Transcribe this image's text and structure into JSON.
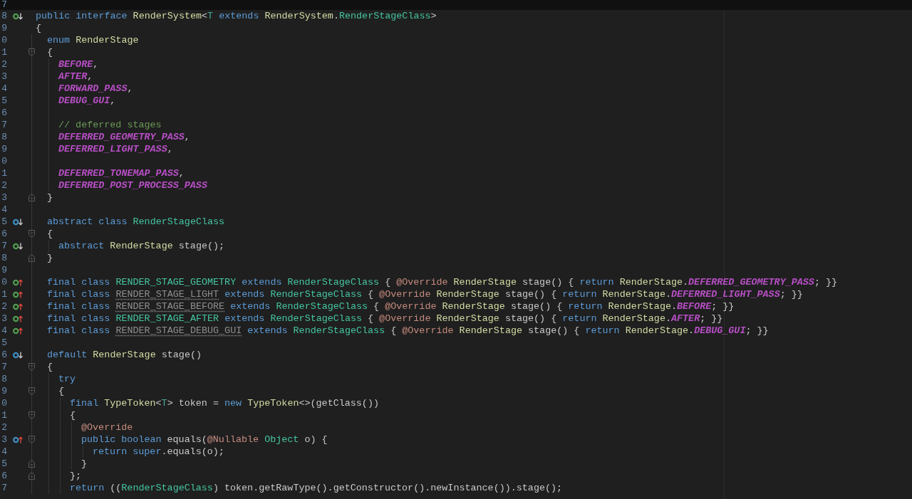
{
  "editor": {
    "lines": [
      {
        "number": "7"
      },
      {
        "number": "8",
        "marker": {
          "kind": "implemented",
          "color": "#4f9d4f"
        },
        "tokens": [
          {
            "text": "public interface ",
            "kind": "keyword"
          },
          {
            "text": "RenderSystem",
            "kind": "type"
          },
          {
            "text": "<",
            "kind": "plain"
          },
          {
            "text": "T",
            "kind": "type-param"
          },
          {
            "text": " extends ",
            "kind": "keyword"
          },
          {
            "text": "RenderSystem",
            "kind": "type"
          },
          {
            "text": ".",
            "kind": "plain"
          },
          {
            "text": "RenderStageClass",
            "kind": "type-ref"
          },
          {
            "text": ">",
            "kind": "plain"
          }
        ]
      },
      {
        "number": "9",
        "tokens": [
          {
            "text": "{",
            "kind": "plain"
          }
        ],
        "children": [
          {
            "number": "0",
            "tokens": [
              {
                "text": "enum ",
                "kind": "keyword"
              },
              {
                "text": "RenderStage",
                "kind": "type"
              }
            ]
          },
          {
            "number": "1",
            "fold": {
              "kind": "start"
            },
            "tokens": [
              {
                "text": "{",
                "kind": "plain"
              }
            ],
            "children": [
              {
                "number": "2",
                "tokens": [
                  {
                    "text": "BEFORE",
                    "kind": "enum-constant"
                  },
                  {
                    "text": ",",
                    "kind": "plain"
                  }
                ]
              },
              {
                "number": "3",
                "tokens": [
                  {
                    "text": "AFTER",
                    "kind": "enum-constant"
                  },
                  {
                    "text": ",",
                    "kind": "plain"
                  }
                ]
              },
              {
                "number": "4",
                "tokens": [
                  {
                    "text": "FORWARD_PASS",
                    "kind": "enum-constant"
                  },
                  {
                    "text": ",",
                    "kind": "plain"
                  }
                ]
              },
              {
                "number": "5",
                "tokens": [
                  {
                    "text": "DEBUG_GUI",
                    "kind": "enum-constant"
                  },
                  {
                    "text": ",",
                    "kind": "plain"
                  }
                ]
              },
              {
                "number": "6"
              },
              {
                "number": "7",
                "tokens": [
                  {
                    "text": "// deferred stages",
                    "kind": "comment"
                  }
                ]
              },
              {
                "number": "8",
                "tokens": [
                  {
                    "text": "DEFERRED_GEOMETRY_PASS",
                    "kind": "enum-constant"
                  },
                  {
                    "text": ",",
                    "kind": "plain"
                  }
                ]
              },
              {
                "number": "9",
                "tokens": [
                  {
                    "text": "DEFERRED_LIGHT_PASS",
                    "kind": "enum-constant"
                  },
                  {
                    "text": ",",
                    "kind": "plain"
                  }
                ]
              },
              {
                "number": "0"
              },
              {
                "number": "1",
                "tokens": [
                  {
                    "text": "DEFERRED_TONEMAP_PASS",
                    "kind": "enum-constant"
                  },
                  {
                    "text": ",",
                    "kind": "plain"
                  }
                ]
              },
              {
                "number": "2",
                "tokens": [
                  {
                    "text": "DEFERRED_POST_PROCESS_PASS",
                    "kind": "enum-constant"
                  }
                ]
              }
            ]
          },
          {
            "number": "3",
            "fold": {
              "kind": "end"
            },
            "tokens": [
              {
                "text": "}",
                "kind": "plain"
              }
            ]
          },
          {
            "number": "4"
          },
          {
            "number": "5",
            "marker": {
              "kind": "implemented",
              "color": "#3d8ec4"
            },
            "tokens": [
              {
                "text": "abstract class ",
                "kind": "keyword"
              },
              {
                "text": "RenderStageClass",
                "kind": "type-ref"
              }
            ]
          },
          {
            "number": "6",
            "fold": {
              "kind": "start"
            },
            "tokens": [
              {
                "text": "{",
                "kind": "plain"
              }
            ],
            "children": [
              {
                "number": "7",
                "marker": {
                  "kind": "implemented",
                  "color": "#4f9d4f"
                },
                "tokens": [
                  {
                    "text": "abstract ",
                    "kind": "keyword"
                  },
                  {
                    "text": "RenderStage",
                    "kind": "type"
                  },
                  {
                    "text": " stage();",
                    "kind": "plain"
                  }
                ]
              }
            ]
          },
          {
            "number": "8",
            "fold": {
              "kind": "end"
            },
            "tokens": [
              {
                "text": "}",
                "kind": "plain"
              }
            ]
          },
          {
            "number": "9"
          },
          {
            "number": "0",
            "marker": {
              "kind": "overriding",
              "color": "#4f9d4f"
            },
            "tokens": [
              {
                "text": "final class ",
                "kind": "keyword"
              },
              {
                "text": "RENDER_STAGE_GEOMETRY",
                "kind": "type-ref"
              },
              {
                "text": " extends ",
                "kind": "keyword"
              },
              {
                "text": "RenderStageClass",
                "kind": "type-ref"
              },
              {
                "text": " { ",
                "kind": "plain"
              },
              {
                "text": "@Override",
                "kind": "annotation"
              },
              {
                "text": " RenderStage",
                "kind": "type"
              },
              {
                "text": " stage() { ",
                "kind": "plain"
              },
              {
                "text": "return",
                "kind": "keyword"
              },
              {
                "text": " RenderStage",
                "kind": "type"
              },
              {
                "text": ".",
                "kind": "plain"
              },
              {
                "text": "DEFERRED_GEOMETRY_PASS",
                "kind": "enum-constant"
              },
              {
                "text": "; }}",
                "kind": "plain"
              }
            ]
          },
          {
            "number": "1",
            "marker": {
              "kind": "overriding",
              "color": "#4f9d4f"
            },
            "tokens": [
              {
                "text": "final class ",
                "kind": "keyword"
              },
              {
                "text": "RENDER_STAGE_LIGHT",
                "kind": "unused"
              },
              {
                "text": " extends ",
                "kind": "keyword"
              },
              {
                "text": "RenderStageClass",
                "kind": "type-ref"
              },
              {
                "text": " { ",
                "kind": "plain"
              },
              {
                "text": "@Override",
                "kind": "annotation"
              },
              {
                "text": " RenderStage",
                "kind": "type"
              },
              {
                "text": " stage() { ",
                "kind": "plain"
              },
              {
                "text": "return",
                "kind": "keyword"
              },
              {
                "text": " RenderStage",
                "kind": "type"
              },
              {
                "text": ".",
                "kind": "plain"
              },
              {
                "text": "DEFERRED_LIGHT_PASS",
                "kind": "enum-constant"
              },
              {
                "text": "; }}",
                "kind": "plain"
              }
            ]
          },
          {
            "number": "2",
            "marker": {
              "kind": "overriding",
              "color": "#4f9d4f"
            },
            "tokens": [
              {
                "text": "final class ",
                "kind": "keyword"
              },
              {
                "text": "RENDER_STAGE_BEFORE",
                "kind": "unused"
              },
              {
                "text": " extends ",
                "kind": "keyword"
              },
              {
                "text": "RenderStageClass",
                "kind": "type-ref"
              },
              {
                "text": " { ",
                "kind": "plain"
              },
              {
                "text": "@Override",
                "kind": "annotation"
              },
              {
                "text": " RenderStage",
                "kind": "type"
              },
              {
                "text": " stage() { ",
                "kind": "plain"
              },
              {
                "text": "return",
                "kind": "keyword"
              },
              {
                "text": " RenderStage",
                "kind": "type"
              },
              {
                "text": ".",
                "kind": "plain"
              },
              {
                "text": "BEFORE",
                "kind": "enum-constant"
              },
              {
                "text": "; }}",
                "kind": "plain"
              }
            ]
          },
          {
            "number": "3",
            "marker": {
              "kind": "overriding",
              "color": "#4f9d4f"
            },
            "tokens": [
              {
                "text": "final class ",
                "kind": "keyword"
              },
              {
                "text": "RENDER_STAGE_AFTER",
                "kind": "type-ref"
              },
              {
                "text": " extends ",
                "kind": "keyword"
              },
              {
                "text": "RenderStageClass",
                "kind": "type-ref"
              },
              {
                "text": " { ",
                "kind": "plain"
              },
              {
                "text": "@Override",
                "kind": "annotation"
              },
              {
                "text": " RenderStage",
                "kind": "type"
              },
              {
                "text": " stage() { ",
                "kind": "plain"
              },
              {
                "text": "return",
                "kind": "keyword"
              },
              {
                "text": " RenderStage",
                "kind": "type"
              },
              {
                "text": ".",
                "kind": "plain"
              },
              {
                "text": "AFTER",
                "kind": "enum-constant"
              },
              {
                "text": "; }}",
                "kind": "plain"
              }
            ]
          },
          {
            "number": "4",
            "marker": {
              "kind": "overriding",
              "color": "#4f9d4f"
            },
            "tokens": [
              {
                "text": "final class ",
                "kind": "keyword"
              },
              {
                "text": "RENDER_STAGE_DEBUG_GUI",
                "kind": "unused"
              },
              {
                "text": " extends ",
                "kind": "keyword"
              },
              {
                "text": "RenderStageClass",
                "kind": "type-ref"
              },
              {
                "text": " { ",
                "kind": "plain"
              },
              {
                "text": "@Override",
                "kind": "annotation"
              },
              {
                "text": " RenderStage",
                "kind": "type"
              },
              {
                "text": " stage() { ",
                "kind": "plain"
              },
              {
                "text": "return",
                "kind": "keyword"
              },
              {
                "text": " RenderStage",
                "kind": "type"
              },
              {
                "text": ".",
                "kind": "plain"
              },
              {
                "text": "DEBUG_GUI",
                "kind": "enum-constant"
              },
              {
                "text": "; }}",
                "kind": "plain"
              }
            ]
          },
          {
            "number": "5"
          },
          {
            "number": "6",
            "marker": {
              "kind": "implemented",
              "color": "#3d8ec4"
            },
            "tokens": [
              {
                "text": "default ",
                "kind": "keyword"
              },
              {
                "text": "RenderStage",
                "kind": "type"
              },
              {
                "text": " stage()",
                "kind": "plain"
              }
            ]
          },
          {
            "number": "7",
            "fold": {
              "kind": "start"
            },
            "tokens": [
              {
                "text": "{",
                "kind": "plain"
              }
            ],
            "children": [
              {
                "number": "8",
                "tokens": [
                  {
                    "text": "try",
                    "kind": "keyword"
                  }
                ]
              },
              {
                "number": "9",
                "fold": {
                  "kind": "start"
                },
                "tokens": [
                  {
                    "text": "{",
                    "kind": "plain"
                  }
                ],
                "children": [
                  {
                    "number": "0",
                    "tokens": [
                      {
                        "text": "final ",
                        "kind": "keyword"
                      },
                      {
                        "text": "TypeToken",
                        "kind": "type"
                      },
                      {
                        "text": "<",
                        "kind": "plain"
                      },
                      {
                        "text": "T",
                        "kind": "type-param"
                      },
                      {
                        "text": "> token = ",
                        "kind": "plain"
                      },
                      {
                        "text": "new",
                        "kind": "keyword"
                      },
                      {
                        "text": " TypeToken",
                        "kind": "type"
                      },
                      {
                        "text": "<>(getClass())",
                        "kind": "plain"
                      }
                    ]
                  },
                  {
                    "number": "1",
                    "fold": {
                      "kind": "start"
                    },
                    "tokens": [
                      {
                        "text": "{",
                        "kind": "plain"
                      }
                    ],
                    "children": [
                      {
                        "number": "2",
                        "tokens": [
                          {
                            "text": "@Override",
                            "kind": "annotation"
                          }
                        ]
                      },
                      {
                        "number": "3",
                        "marker": {
                          "kind": "overriding",
                          "color": "#3d8ec4"
                        },
                        "fold": {
                          "kind": "start"
                        },
                        "tokens": [
                          {
                            "text": "public boolean",
                            "kind": "keyword"
                          },
                          {
                            "text": " equals(",
                            "kind": "plain"
                          },
                          {
                            "text": "@Nullable",
                            "kind": "annotation"
                          },
                          {
                            "text": " Object",
                            "kind": "type-ref"
                          },
                          {
                            "text": " o) {",
                            "kind": "plain"
                          }
                        ],
                        "children": [
                          {
                            "number": "4",
                            "tokens": [
                              {
                                "text": "return super",
                                "kind": "keyword"
                              },
                              {
                                "text": ".equals(o);",
                                "kind": "plain"
                              }
                            ]
                          }
                        ]
                      },
                      {
                        "number": "5",
                        "fold": {
                          "kind": "end"
                        },
                        "tokens": [
                          {
                            "text": "}",
                            "kind": "plain"
                          }
                        ]
                      }
                    ]
                  },
                  {
                    "number": "6",
                    "fold": {
                      "kind": "end"
                    },
                    "tokens": [
                      {
                        "text": "};",
                        "kind": "plain"
                      }
                    ]
                  },
                  {
                    "number": "7",
                    "tokens": [
                      {
                        "text": "return ",
                        "kind": "keyword"
                      },
                      {
                        "text": "((",
                        "kind": "plain"
                      },
                      {
                        "text": "RenderStageClass",
                        "kind": "type-ref"
                      },
                      {
                        "text": ") token.getRawType().getConstructor().newInstance()).stage();",
                        "kind": "plain"
                      }
                    ]
                  }
                ]
              }
            ]
          }
        ]
      }
    ]
  }
}
